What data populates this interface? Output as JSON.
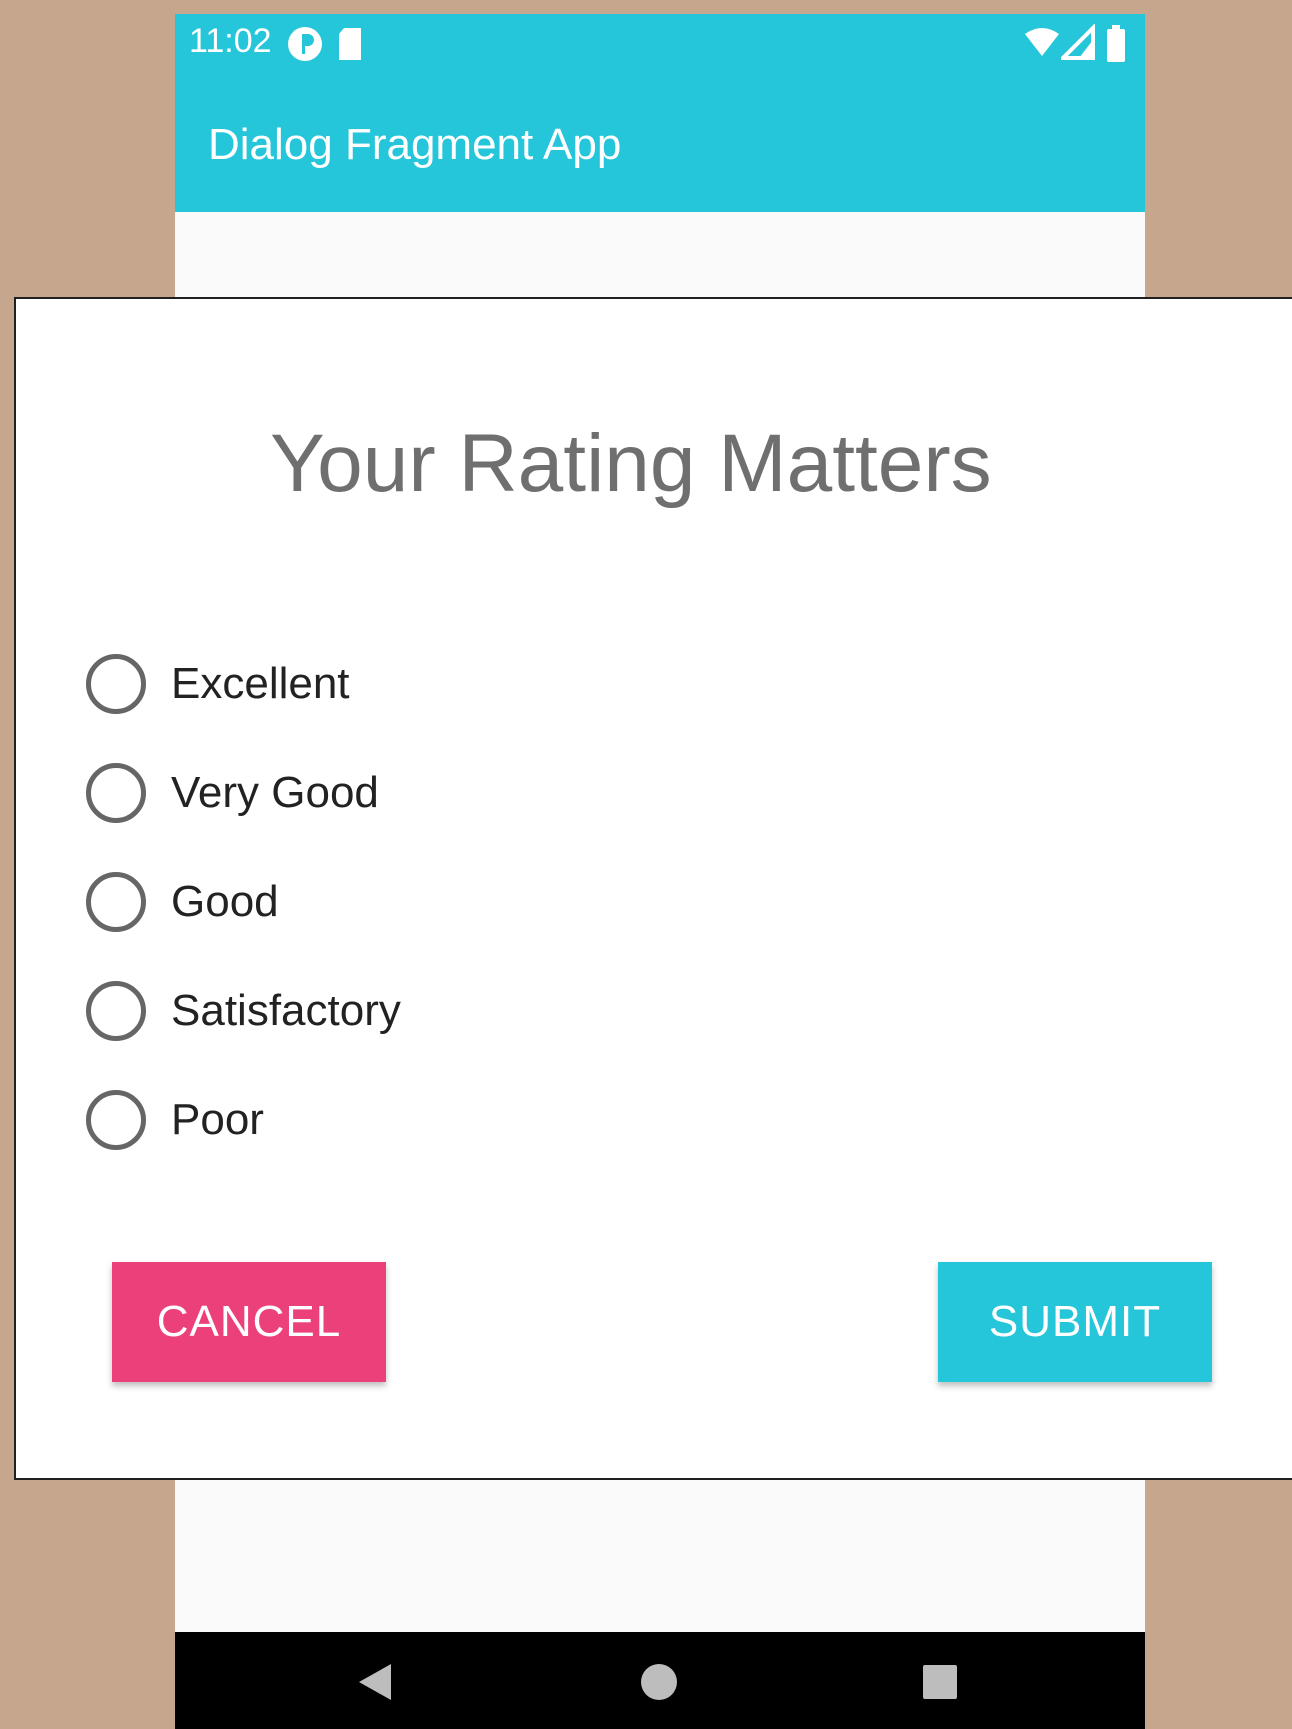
{
  "status_bar": {
    "time": "11:02",
    "icons": [
      "app-notification-icon",
      "sd-card-icon",
      "wifi-icon",
      "signal-icon",
      "battery-icon"
    ],
    "color": "#26c6da"
  },
  "app_bar": {
    "title": "Dialog Fragment App",
    "color": "#26c6da"
  },
  "dialog": {
    "title": "Your Rating Matters",
    "options": [
      {
        "label": "Excellent",
        "selected": false
      },
      {
        "label": "Very Good",
        "selected": false
      },
      {
        "label": "Good",
        "selected": false
      },
      {
        "label": "Satisfactory",
        "selected": false
      },
      {
        "label": "Poor",
        "selected": false
      }
    ],
    "cancel_label": "CANCEL",
    "submit_label": "SUBMIT",
    "cancel_color": "#ec407a",
    "submit_color": "#26c6da"
  },
  "nav_bar": {
    "icons": [
      "back-icon",
      "home-icon",
      "recents-icon"
    ]
  }
}
